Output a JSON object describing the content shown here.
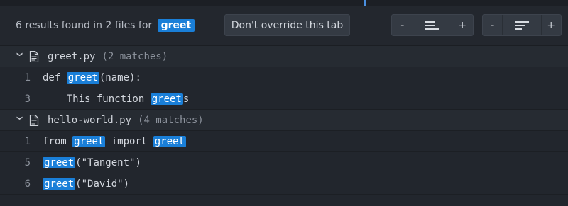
{
  "summary": {
    "text": "6 results found in 2 files for",
    "query": "greet"
  },
  "toolbar": {
    "override_label": "Don't override this tab",
    "group1": {
      "minus": "-",
      "plus": "+"
    },
    "group2": {
      "minus": "-",
      "plus": "+"
    }
  },
  "files": [
    {
      "name": "greet.py",
      "matches": "(2 matches)",
      "rows": [
        {
          "line": "1",
          "parts": [
            "def ",
            "greet",
            "(name):"
          ]
        },
        {
          "line": "3",
          "parts": [
            "    This function ",
            "greet",
            "s"
          ]
        }
      ]
    },
    {
      "name": "hello-world.py",
      "matches": "(4 matches)",
      "rows": [
        {
          "line": "1",
          "parts": [
            "from ",
            "greet",
            " import ",
            "greet",
            ""
          ]
        },
        {
          "line": "5",
          "parts": [
            "",
            "greet",
            "(\"Tangent\")"
          ]
        },
        {
          "line": "6",
          "parts": [
            "",
            "greet",
            "(\"David\")"
          ]
        }
      ]
    }
  ],
  "colors": {
    "highlight": "#1a7fd8",
    "background": "#22262d"
  },
  "icons": {
    "collapse": "chevron-down-icon",
    "file": "file-icon"
  }
}
